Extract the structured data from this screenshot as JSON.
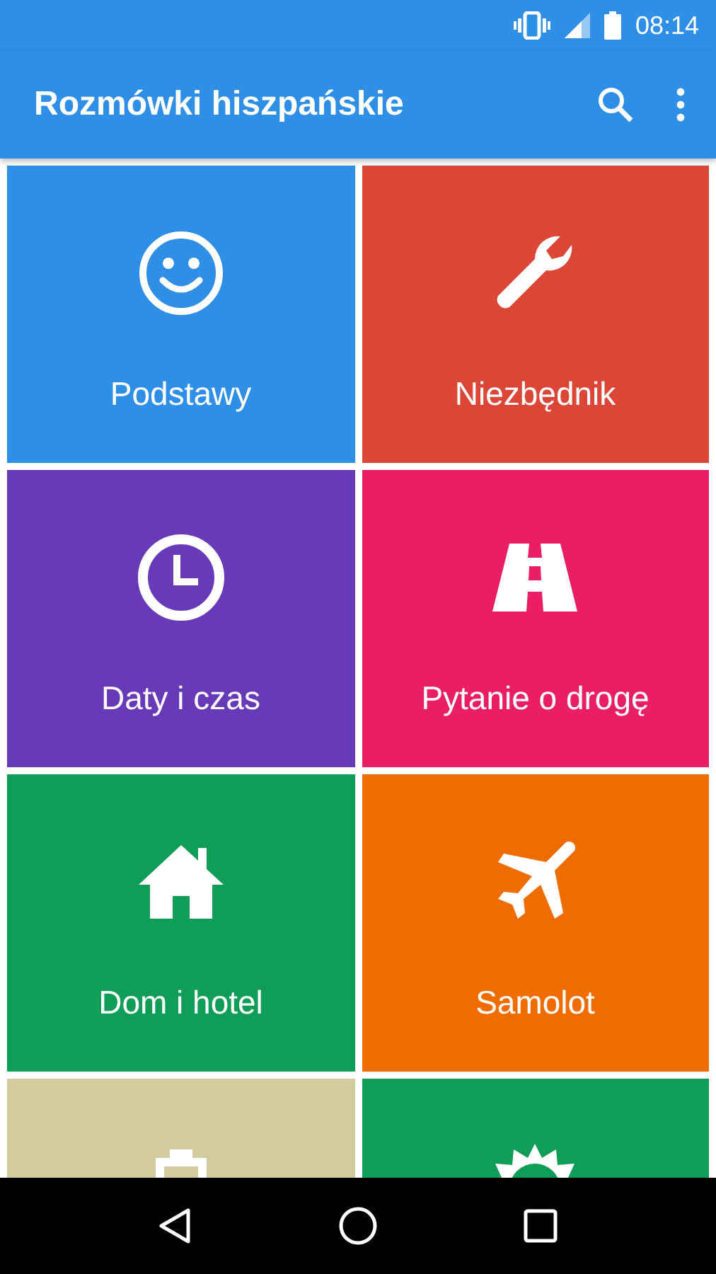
{
  "status_bar": {
    "time": "08:14"
  },
  "app_bar": {
    "title": "Rozmówki hiszpańskie"
  },
  "tiles": [
    {
      "label": "Podstawy",
      "kind": "smiley",
      "color": "#2f8fe6"
    },
    {
      "label": "Niezbędnik",
      "kind": "wrench",
      "color": "#dc4637"
    },
    {
      "label": "Daty i czas",
      "kind": "clock",
      "color": "#673ab7"
    },
    {
      "label": "Pytanie o drogę",
      "kind": "road",
      "color": "#e91e63"
    },
    {
      "label": "Dom i hotel",
      "kind": "house",
      "color": "#0f9d58"
    },
    {
      "label": "Samolot",
      "kind": "plane",
      "color": "#ef6c00"
    },
    {
      "kind": "ship",
      "color": "#d1cb9f"
    },
    {
      "kind": "sun",
      "color": "#0f9d58"
    }
  ]
}
